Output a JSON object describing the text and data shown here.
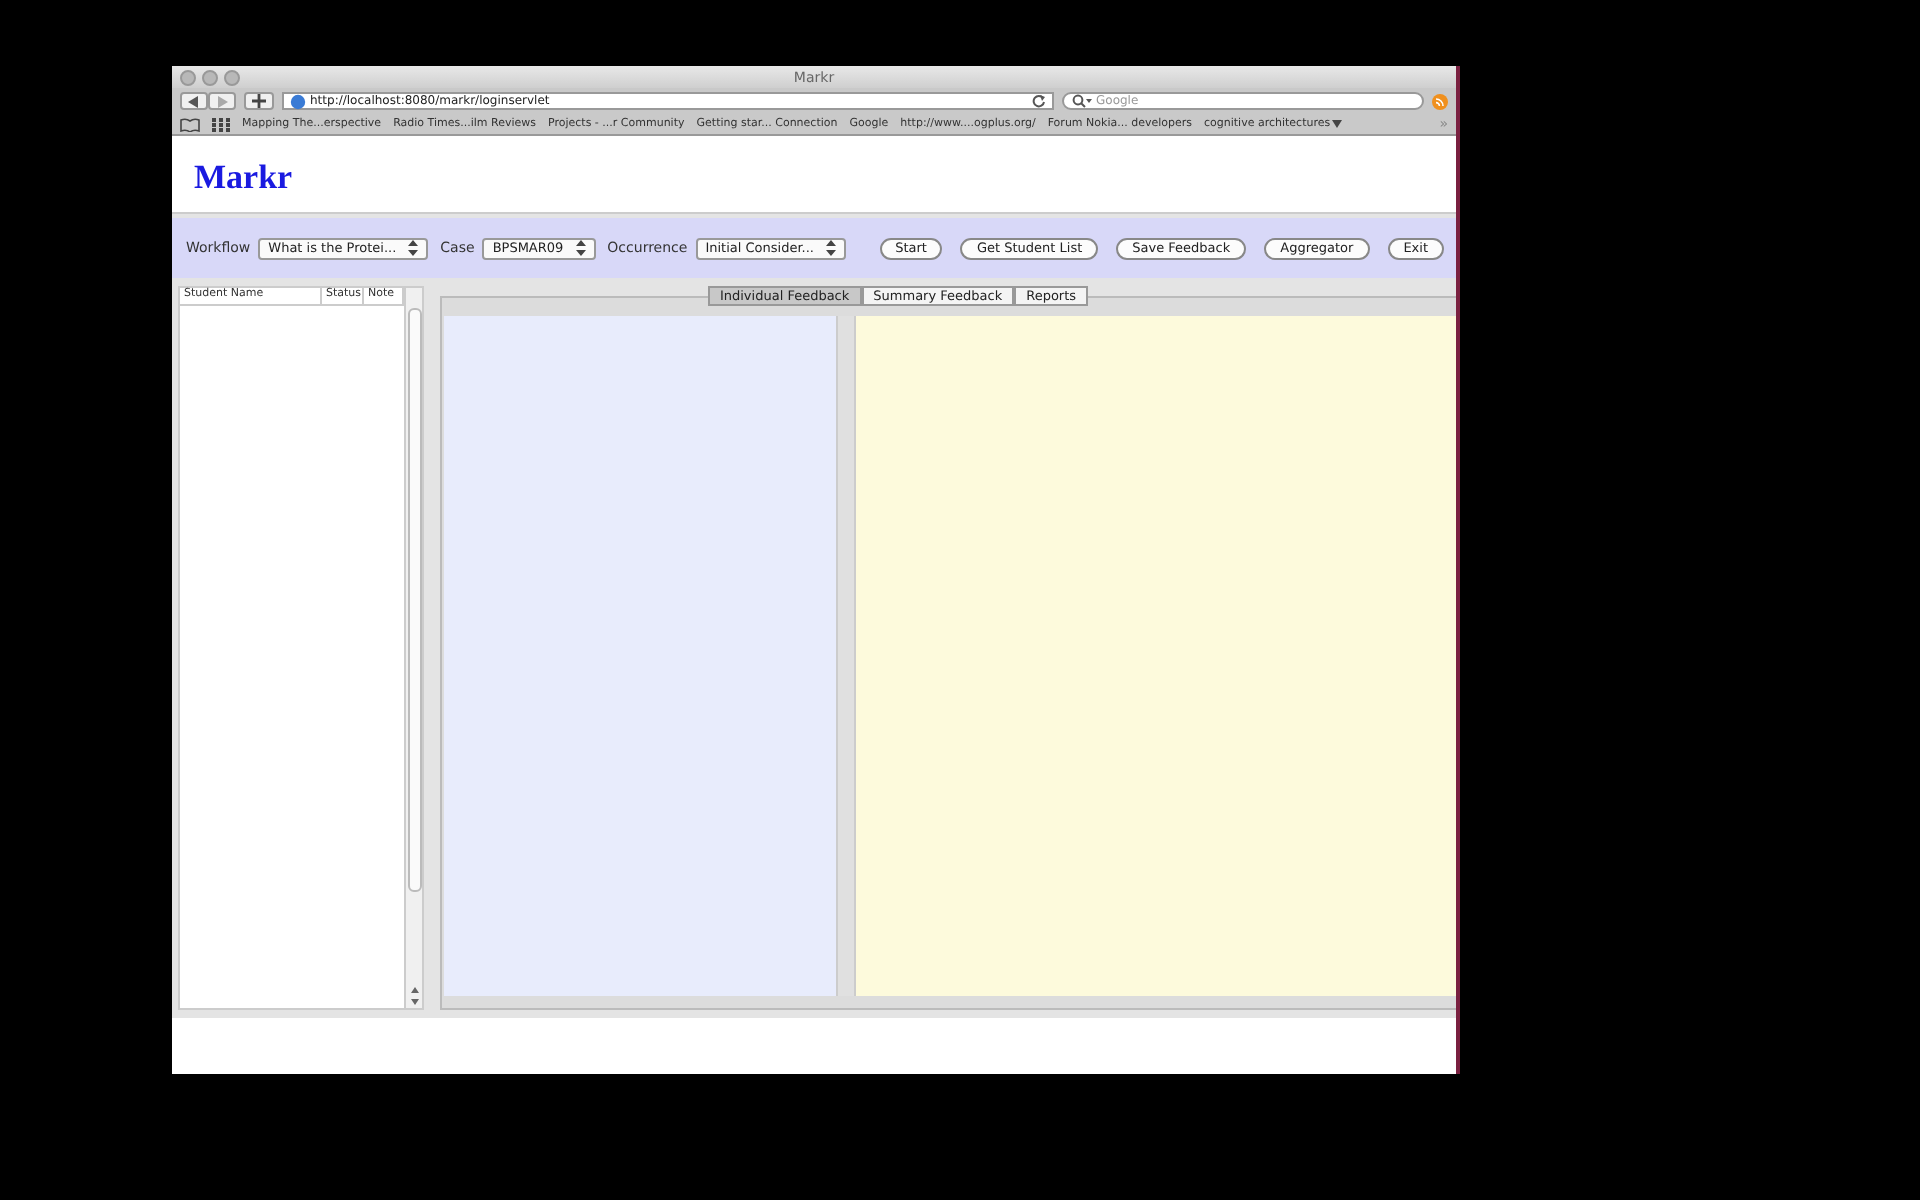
{
  "window": {
    "title": "Markr"
  },
  "browser": {
    "url": "http://localhost:8080/markr/loginservlet",
    "search": {
      "placeholder": "Google"
    },
    "bookmarks": [
      "Mapping The...erspective",
      "Radio Times...ilm Reviews",
      "Projects - ...r Community",
      "Getting star... Connection",
      "Google",
      "http://www....ogplus.org/",
      "Forum Nokia... developers",
      "cognitive architectures"
    ],
    "overflow": "»"
  },
  "page": {
    "heading": "Markr"
  },
  "toolbar": {
    "fields": [
      {
        "label": "Workflow",
        "value": "What is the Protei..."
      },
      {
        "label": "Case",
        "value": "BPSMAR09"
      },
      {
        "label": "Occurrence",
        "value": "Initial Consider..."
      }
    ],
    "buttons": [
      "Start",
      "Get Student List",
      "Save Feedback",
      "Aggregator",
      "Exit"
    ]
  },
  "student_table": {
    "columns": [
      "Student Name",
      "Status",
      "Note"
    ]
  },
  "tabs": [
    {
      "label": "Individual Feedback",
      "selected": true
    },
    {
      "label": "Summary Feedback",
      "selected": false
    },
    {
      "label": "Reports",
      "selected": false
    }
  ]
}
